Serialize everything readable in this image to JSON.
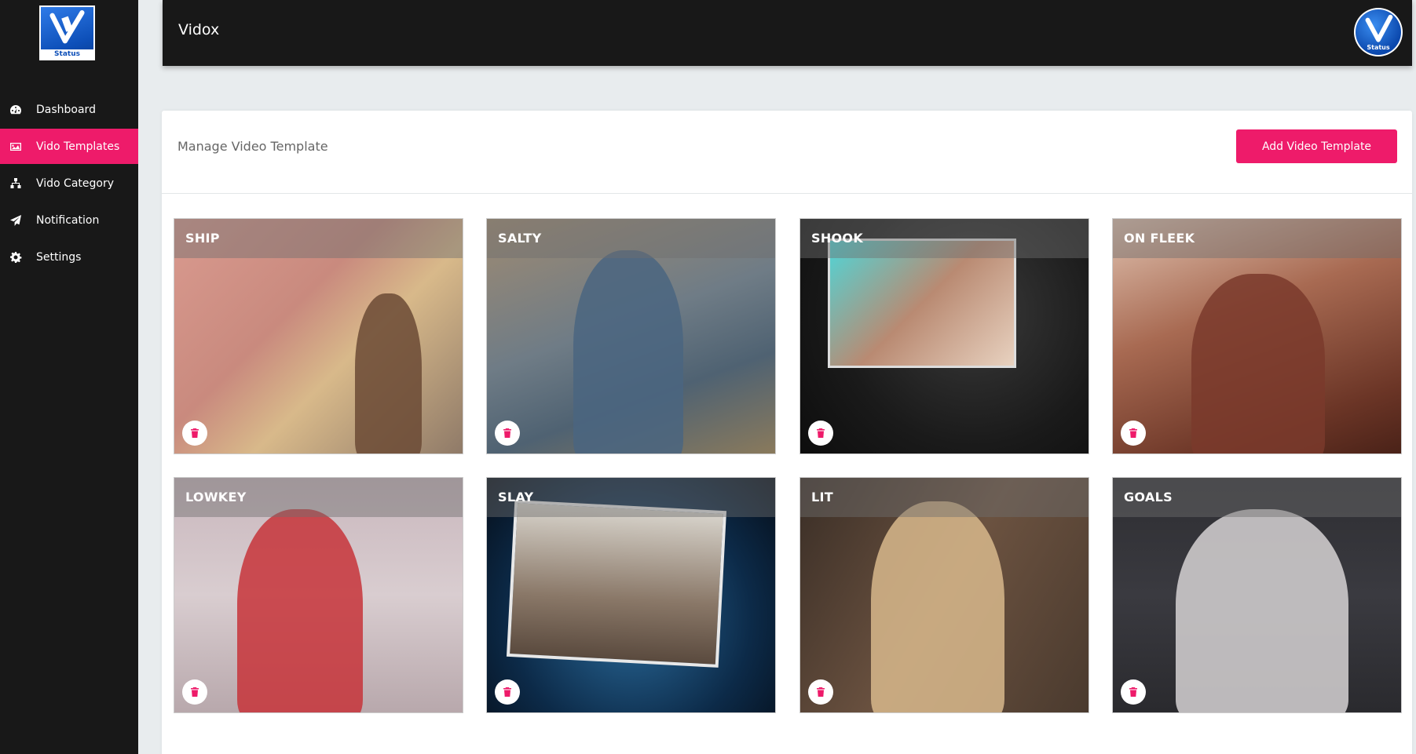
{
  "brand": {
    "logo_text": "Status",
    "app_title": "Vidox"
  },
  "sidebar": {
    "items": [
      {
        "label": "Dashboard",
        "icon": "dashboard-icon",
        "active": false
      },
      {
        "label": "Vido Templates",
        "icon": "image-icon",
        "active": true
      },
      {
        "label": "Vido Category",
        "icon": "sitemap-icon",
        "active": false
      },
      {
        "label": "Notification",
        "icon": "paper-plane-icon",
        "active": false
      },
      {
        "label": "Settings",
        "icon": "gear-icon",
        "active": false
      }
    ]
  },
  "header": {
    "avatar_text": "Status"
  },
  "main": {
    "title": "Manage Video Template",
    "add_button_label": "Add Video Template"
  },
  "templates": [
    {
      "label": "SHIP"
    },
    {
      "label": "SALTY"
    },
    {
      "label": "SHOOK"
    },
    {
      "label": "ON FLEEK"
    },
    {
      "label": "LOWKEY"
    },
    {
      "label": "SLAY"
    },
    {
      "label": "LIT"
    },
    {
      "label": "GOALS"
    }
  ],
  "colors": {
    "accent": "#ee1b6a",
    "sidebar_bg": "#181818",
    "page_bg": "#e8ecee"
  }
}
